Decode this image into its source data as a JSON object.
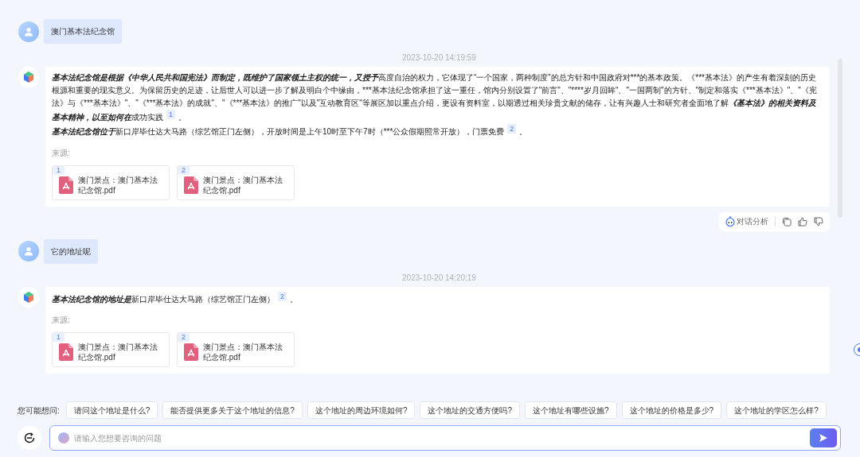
{
  "conversation": [
    {
      "kind": "user",
      "text": "澳门基本法纪念馆"
    },
    {
      "kind": "assistant",
      "time": "2023-10-20 14:19:59",
      "paragraphs": [
        [
          {
            "kind": "emphasis",
            "text": "基本法纪念馆是根据《中华人民共和国宪法》而制定，既维护了国家领土主权的统一，又授予"
          },
          {
            "kind": "text",
            "text": "高度自治的权力，它体现了“一个国家，两种制度”的总方针和中国政府对***的基本政策。《***基本法》的产生有着深刻的历史根源和重要的现实意义。为保留历史的足迹，让后世人可以进一步了解及明白个中缘由，***基本法纪念馆承担了这一重任，馆内分别设置了\"前言\"、\"****岁月回眸\"、\"一国两制\"的方针、\"制定和落实《***基本法》\"、\"《宪法》与《***基本法》\"、\"《***基本法》的成就\"、\"《***基本法》的推广\"以及\"互动教育区\"等展区加以重点介绍，更设有资料室，以期透过相关珍贵文献的储存，让有兴趣人士和研究者全面地了解"
          },
          {
            "kind": "emphasis",
            "text": "《基本法》的相关资料及基本精神，以至如何在"
          },
          {
            "kind": "text",
            "text": "成功实践"
          },
          {
            "kind": "citation",
            "text": "1"
          },
          {
            "kind": "text",
            "text": "。"
          }
        ],
        [
          {
            "kind": "emphasis",
            "text": "基本法纪念馆位于"
          },
          {
            "kind": "text",
            "text": "新口岸毕仕达大马路（综艺馆正门左侧），开放时间是上午10时至下午7时（***公众假期照常开放），门票免费"
          },
          {
            "kind": "citation",
            "text": "2"
          },
          {
            "kind": "text",
            "text": "。"
          }
        ]
      ],
      "sources_label": "来源:",
      "sources": [
        {
          "number": "1",
          "name": "澳门景点：澳门基本法纪念馆.pdf"
        },
        {
          "number": "2",
          "name": "澳门景点：澳门基本法纪念馆.pdf"
        }
      ],
      "actions": {
        "analysis": "对话分析"
      }
    },
    {
      "kind": "user",
      "text": "它的地址呢"
    },
    {
      "kind": "assistant",
      "time": "2023-10-20 14:20:19",
      "paragraphs": [
        [
          {
            "kind": "emphasis",
            "text": "基本法纪念馆的地址是"
          },
          {
            "kind": "text",
            "text": "新口岸毕仕达大马路（综艺馆正门左侧）"
          },
          {
            "kind": "citation",
            "text": "2"
          },
          {
            "kind": "text",
            "text": "。"
          }
        ]
      ],
      "sources_label": "来源:",
      "sources": [
        {
          "number": "1",
          "name": "澳门景点：澳门基本法纪念馆.pdf"
        },
        {
          "number": "2",
          "name": "澳门景点：澳门基本法纪念馆.pdf"
        }
      ]
    }
  ],
  "suggestions": {
    "label": "您可能想问:",
    "items": [
      "请问这个地址是什么?",
      "能否提供更多关于这个地址的信息?",
      "这个地址的周边环境如何?",
      "这个地址的交通方便吗?",
      "这个地址有哪些设施?",
      "这个地址的价格是多少?",
      "这个地址的学区怎么样?"
    ]
  },
  "input": {
    "placeholder": "请输入您想要咨询的问题"
  }
}
